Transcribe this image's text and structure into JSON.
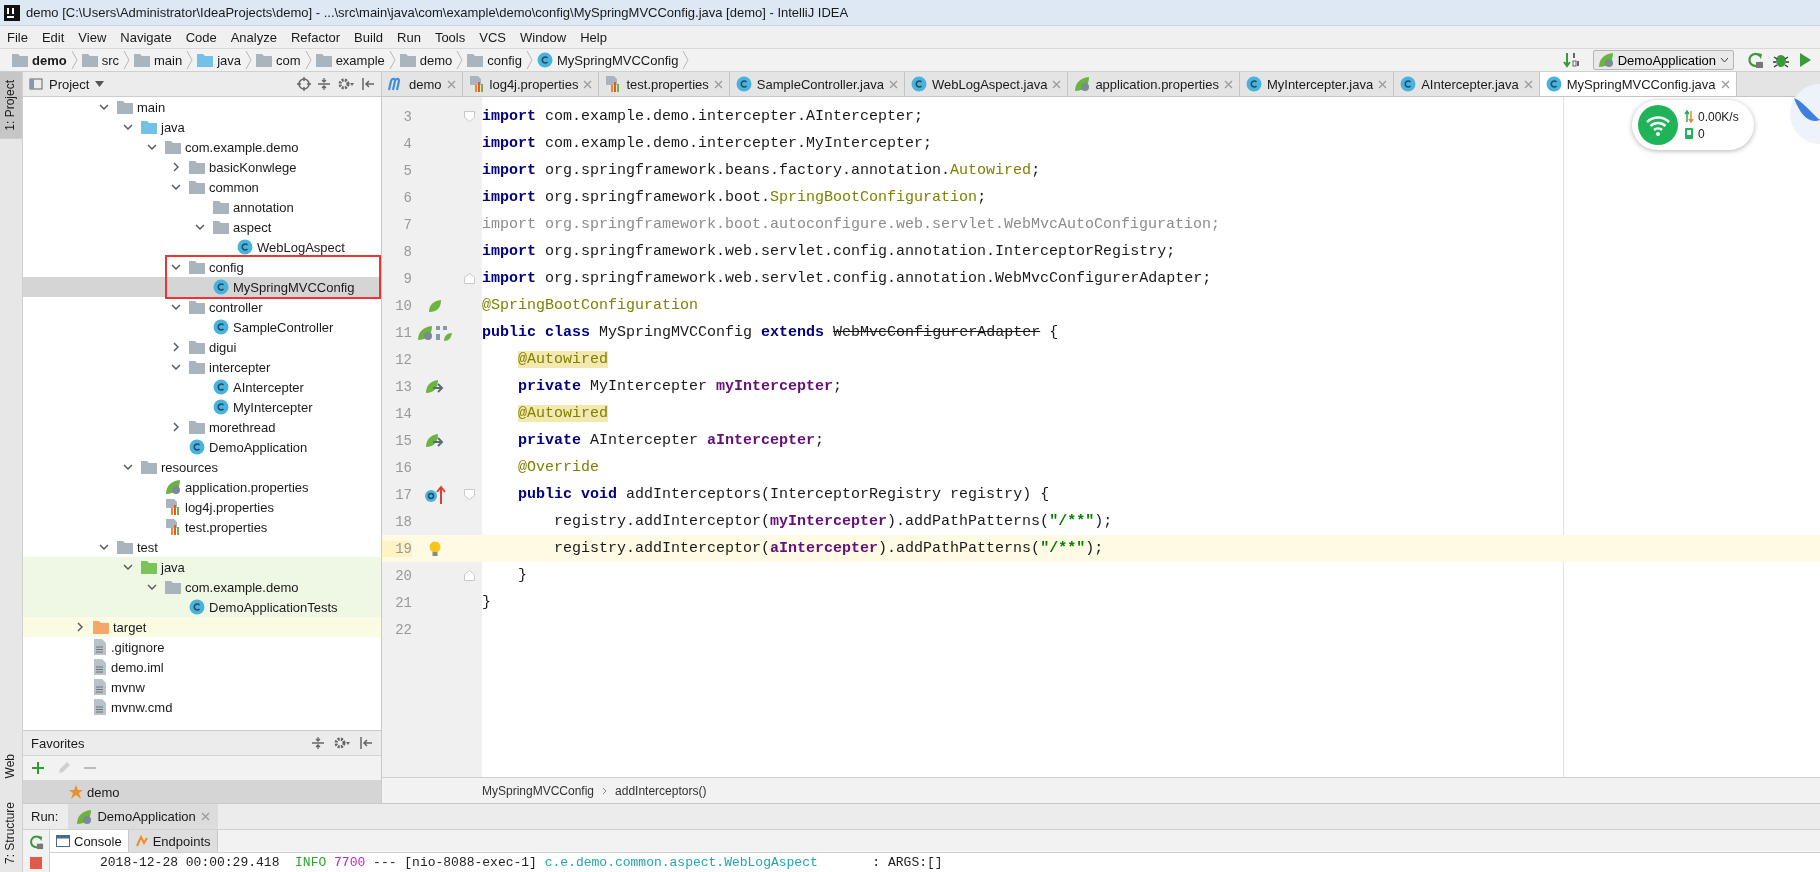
{
  "window": {
    "title": "demo [C:\\Users\\Administrator\\IdeaProjects\\demo] - ...\\src\\main\\java\\com\\example\\demo\\config\\MySpringMVCConfig.java [demo] - IntelliJ IDEA"
  },
  "menu": [
    "File",
    "Edit",
    "View",
    "Navigate",
    "Code",
    "Analyze",
    "Refactor",
    "Build",
    "Run",
    "Tools",
    "VCS",
    "Window",
    "Help"
  ],
  "navigation": {
    "crumbs": [
      {
        "label": "demo",
        "kind": "module"
      },
      {
        "label": "src",
        "kind": "folder"
      },
      {
        "label": "main",
        "kind": "folder"
      },
      {
        "label": "java",
        "kind": "source"
      },
      {
        "label": "com",
        "kind": "package"
      },
      {
        "label": "example",
        "kind": "package"
      },
      {
        "label": "demo",
        "kind": "package"
      },
      {
        "label": "config",
        "kind": "package"
      },
      {
        "label": "MySpringMVCConfig",
        "kind": "class"
      }
    ],
    "run_config": "DemoApplication"
  },
  "side_stripe": {
    "top": [
      {
        "label": "1: Project",
        "selected": true
      }
    ],
    "bottom": [
      {
        "label": "Web",
        "selected": false
      },
      {
        "label": "7: Structure",
        "selected": false
      }
    ]
  },
  "project_panel": {
    "title": "Project",
    "tree": {
      "scrolled_branch": [
        {
          "label": "main",
          "kind": "folder",
          "expanded": true,
          "selected": false,
          "children": [
            {
              "label": "java",
              "kind": "source",
              "expanded": true,
              "selected": false,
              "children": [
                {
                  "label": "com.example.demo",
                  "kind": "package",
                  "expanded": true,
                  "selected": false,
                  "children": [
                    {
                      "label": "basicKonwlege",
                      "kind": "package",
                      "expanded": false,
                      "selected": false
                    },
                    {
                      "label": "common",
                      "kind": "package",
                      "expanded": true,
                      "selected": false,
                      "children": [
                        {
                          "label": "annotation",
                          "kind": "package",
                          "selected": false
                        },
                        {
                          "label": "aspect",
                          "kind": "package",
                          "expanded": true,
                          "selected": false,
                          "children": [
                            {
                              "label": "WebLogAspect",
                              "kind": "class",
                              "selected": false
                            }
                          ]
                        }
                      ]
                    },
                    {
                      "label": "config",
                      "kind": "package",
                      "expanded": true,
                      "selected": false,
                      "annotated": true,
                      "children": [
                        {
                          "label": "MySpringMVCConfig",
                          "kind": "class",
                          "selected": true,
                          "annotated": true
                        }
                      ]
                    },
                    {
                      "label": "controller",
                      "kind": "package",
                      "expanded": true,
                      "selected": false,
                      "children": [
                        {
                          "label": "SampleController",
                          "kind": "class",
                          "selected": false
                        }
                      ]
                    },
                    {
                      "label": "digui",
                      "kind": "package",
                      "expanded": false,
                      "selected": false
                    },
                    {
                      "label": "intercepter",
                      "kind": "package",
                      "expanded": true,
                      "selected": false,
                      "children": [
                        {
                          "label": "AIntercepter",
                          "kind": "class",
                          "selected": false
                        },
                        {
                          "label": "MyIntercepter",
                          "kind": "class",
                          "selected": false
                        }
                      ]
                    },
                    {
                      "label": "morethread",
                      "kind": "package",
                      "expanded": false,
                      "selected": false
                    },
                    {
                      "label": "DemoApplication",
                      "kind": "spring-app",
                      "selected": false
                    }
                  ]
                }
              ]
            },
            {
              "label": "resources",
              "kind": "resources",
              "expanded": true,
              "selected": false,
              "children": [
                {
                  "label": "application.properties",
                  "kind": "spring-props",
                  "selected": false
                },
                {
                  "label": "log4j.properties",
                  "kind": "props",
                  "selected": false
                },
                {
                  "label": "test.properties",
                  "kind": "props",
                  "selected": false
                }
              ]
            }
          ]
        },
        {
          "label": "test",
          "kind": "folder",
          "expanded": true,
          "selected": false,
          "children": [
            {
              "label": "java",
              "kind": "test-source",
              "expanded": true,
              "selected": false,
              "scope": {
                "kind": "test"
              },
              "children": [
                {
                  "label": "com.example.demo",
                  "kind": "package",
                  "expanded": true,
                  "selected": false,
                  "scope": {
                    "kind": "test"
                  },
                  "children": [
                    {
                      "label": "DemoApplicationTests",
                      "kind": "test-class",
                      "selected": false,
                      "scope": {
                        "kind": "test"
                      }
                    }
                  ]
                }
              ]
            }
          ]
        }
      ],
      "items": [
        {
          "label": "target",
          "kind": "excluded",
          "expanded": false,
          "selected": false,
          "scope": {
            "kind": "excluded"
          }
        },
        {
          "label": ".gitignore",
          "kind": "file",
          "selected": false
        },
        {
          "label": "demo.iml",
          "kind": "iml",
          "selected": false
        },
        {
          "label": "mvnw",
          "kind": "file",
          "selected": false
        },
        {
          "label": "mvnw.cmd",
          "kind": "file",
          "selected": false
        }
      ]
    }
  },
  "favorites": {
    "title": "Favorites",
    "items": [
      {
        "label": "demo",
        "selected": true
      }
    ]
  },
  "editor": {
    "tabs": [
      {
        "label": "demo",
        "kind": "maven",
        "selected": false
      },
      {
        "label": "log4j.properties",
        "kind": "props",
        "selected": false
      },
      {
        "label": "test.properties",
        "kind": "props",
        "selected": false
      },
      {
        "label": "SampleController.java",
        "kind": "class",
        "selected": false
      },
      {
        "label": "WebLogAspect.java",
        "kind": "class",
        "selected": false
      },
      {
        "label": "application.properties",
        "kind": "spring-props",
        "selected": false
      },
      {
        "label": "MyIntercepter.java",
        "kind": "class",
        "selected": false
      },
      {
        "label": "AIntercepter.java",
        "kind": "class",
        "selected": false
      },
      {
        "label": "MySpringMVCConfig.java",
        "kind": "class",
        "selected": true
      }
    ],
    "lines": [
      {
        "number": "3",
        "current": false,
        "fold": {
          "kind": "start"
        },
        "tokens": [
          {
            "text": "import",
            "kind": "kw"
          },
          {
            "text": " com.example.demo.intercepter.AIntercepter;",
            "kind": "plain"
          }
        ]
      },
      {
        "number": "4",
        "current": false,
        "tokens": [
          {
            "text": "import",
            "kind": "kw"
          },
          {
            "text": " com.example.demo.intercepter.MyIntercepter;",
            "kind": "plain"
          }
        ]
      },
      {
        "number": "5",
        "current": false,
        "tokens": [
          {
            "text": "import",
            "kind": "kw"
          },
          {
            "text": " org.springframework.beans.factory.annotation.",
            "kind": "plain"
          },
          {
            "text": "Autowired",
            "kind": "ann"
          },
          {
            "text": ";",
            "kind": "plain"
          }
        ]
      },
      {
        "number": "6",
        "current": false,
        "tokens": [
          {
            "text": "import",
            "kind": "kw"
          },
          {
            "text": " org.springframework.boot.",
            "kind": "plain"
          },
          {
            "text": "SpringBootConfiguration",
            "kind": "ann"
          },
          {
            "text": ";",
            "kind": "plain"
          }
        ]
      },
      {
        "number": "7",
        "current": false,
        "tokens": [
          {
            "text": "import org.springframework.boot.autoconfigure.web.servlet.WebMvcAutoConfiguration;",
            "kind": "unused"
          }
        ]
      },
      {
        "number": "8",
        "current": false,
        "tokens": [
          {
            "text": "import",
            "kind": "kw"
          },
          {
            "text": " org.springframework.web.servlet.config.annotation.InterceptorRegistry;",
            "kind": "plain"
          }
        ]
      },
      {
        "number": "9",
        "current": false,
        "fold": {
          "kind": "end"
        },
        "tokens": [
          {
            "text": "import",
            "kind": "kw"
          },
          {
            "text": " org.springframework.web.servlet.config.annotation.WebMvcConfigurerAdapter;",
            "kind": "plain"
          }
        ]
      },
      {
        "number": "10",
        "current": false,
        "gutter": {
          "kind": "bean"
        },
        "tokens": [
          {
            "text": "@SpringBootConfiguration",
            "kind": "ann"
          }
        ]
      },
      {
        "number": "11",
        "current": false,
        "gutter": {
          "kind": "class-bean"
        },
        "tokens": [
          {
            "text": "public class",
            "kind": "kw"
          },
          {
            "text": " MySpringMVCConfig ",
            "kind": "plain"
          },
          {
            "text": "extends",
            "kind": "kw"
          },
          {
            "text": " WebMvcConfigurerAdapter",
            "kind": "deprecated"
          },
          {
            "text": " {",
            "kind": "plain"
          }
        ]
      },
      {
        "number": "12",
        "current": false,
        "tokens": [
          {
            "text": "    @Autowired",
            "kind": "marked"
          }
        ]
      },
      {
        "number": "13",
        "current": false,
        "gutter": {
          "kind": "autowired"
        },
        "tokens": [
          {
            "text": "    private",
            "kind": "kw"
          },
          {
            "text": " MyIntercepter ",
            "kind": "plain"
          },
          {
            "text": "myIntercepter",
            "kind": "field"
          },
          {
            "text": ";",
            "kind": "plain"
          }
        ]
      },
      {
        "number": "14",
        "current": false,
        "tokens": [
          {
            "text": "    @Autowired",
            "kind": "marked"
          }
        ]
      },
      {
        "number": "15",
        "current": false,
        "gutter": {
          "kind": "autowired"
        },
        "tokens": [
          {
            "text": "    private",
            "kind": "kw"
          },
          {
            "text": " AIntercepter ",
            "kind": "plain"
          },
          {
            "text": "aIntercepter",
            "kind": "field"
          },
          {
            "text": ";",
            "kind": "plain"
          }
        ]
      },
      {
        "number": "16",
        "current": false,
        "tokens": [
          {
            "text": "    @Override",
            "kind": "ann"
          }
        ]
      },
      {
        "number": "17",
        "current": false,
        "gutter": {
          "kind": "override"
        },
        "fold": {
          "kind": "start"
        },
        "tokens": [
          {
            "text": "    public void",
            "kind": "kw"
          },
          {
            "text": " addInterceptors(InterceptorRegistry registry) {",
            "kind": "plain"
          }
        ]
      },
      {
        "number": "18",
        "current": false,
        "tokens": [
          {
            "text": "        registry.addInterceptor(",
            "kind": "plain"
          },
          {
            "text": "myIntercepter",
            "kind": "field"
          },
          {
            "text": ").addPathPatterns(",
            "kind": "plain"
          },
          {
            "text": "\"/**\"",
            "kind": "string"
          },
          {
            "text": ");",
            "kind": "plain"
          }
        ]
      },
      {
        "number": "19",
        "current": true,
        "gutter": {
          "kind": "bulb"
        },
        "tokens": [
          {
            "text": "        registry.addInterceptor(",
            "kind": "plain"
          },
          {
            "text": "aIntercepter",
            "kind": "field"
          },
          {
            "text": ").addPathPatterns(",
            "kind": "plain"
          },
          {
            "text": "\"/**\"",
            "kind": "string"
          },
          {
            "text": ");",
            "kind": "plain"
          }
        ]
      },
      {
        "number": "20",
        "current": false,
        "fold": {
          "kind": "end"
        },
        "tokens": [
          {
            "text": "    }",
            "kind": "plain"
          }
        ]
      },
      {
        "number": "21",
        "current": false,
        "tokens": [
          {
            "text": "}",
            "kind": "plain"
          }
        ]
      },
      {
        "number": "22",
        "current": false
      }
    ],
    "breadcrumb": [
      "MySpringMVCConfig",
      "addInterceptors()"
    ]
  },
  "network_widget": {
    "speed": "0.00K/s",
    "count": "0"
  },
  "run_panel": {
    "label": "Run:",
    "tabs": [
      {
        "label": "DemoApplication",
        "selected": true
      }
    ],
    "console_tabs": [
      {
        "label": "Console",
        "selected": true
      },
      {
        "label": "Endpoints",
        "selected": false
      }
    ],
    "console_line": [
      {
        "text": "2018-12-28 00:00:29.418  ",
        "kind": "plain"
      },
      {
        "text": "INFO",
        "kind": "info"
      },
      {
        "text": " 7700",
        "kind": "pid"
      },
      {
        "text": " --- [nio-8088-exec-1] ",
        "kind": "plain"
      },
      {
        "text": "c.e.demo.common.aspect.WebLogAspect",
        "kind": "logger"
      },
      {
        "text": "       : ARGS:[]",
        "kind": "plain"
      }
    ]
  }
}
